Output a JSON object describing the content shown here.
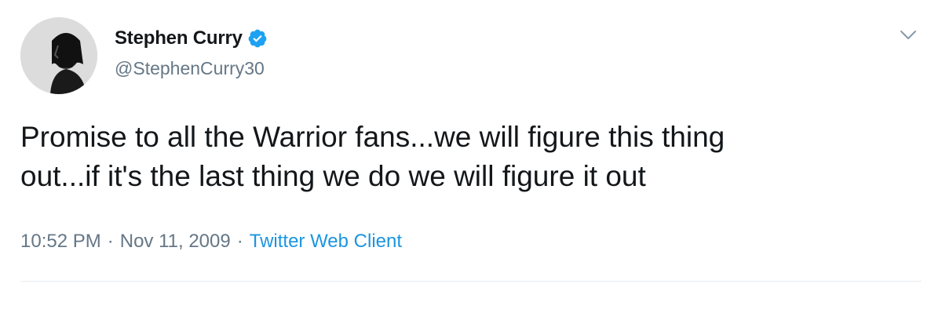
{
  "author": {
    "display_name": "Stephen Curry",
    "handle": "@StephenCurry30",
    "verified": true,
    "avatar_icon": "profile-photo"
  },
  "tweet": {
    "text_line1": "Promise to all the Warrior fans...we will figure this thing",
    "text_line2": "out...if it's the last thing we do we will figure it out"
  },
  "meta": {
    "time": "10:52 PM",
    "separator": "·",
    "date": "Nov 11, 2009",
    "source": "Twitter Web Client"
  },
  "icons": {
    "verified": "verified-badge-icon",
    "menu": "chevron-down-icon"
  },
  "colors": {
    "text": "#14171a",
    "secondary": "#657786",
    "link": "#1b95e0",
    "verified": "#1da1f2",
    "divider": "#e6ecf0"
  }
}
